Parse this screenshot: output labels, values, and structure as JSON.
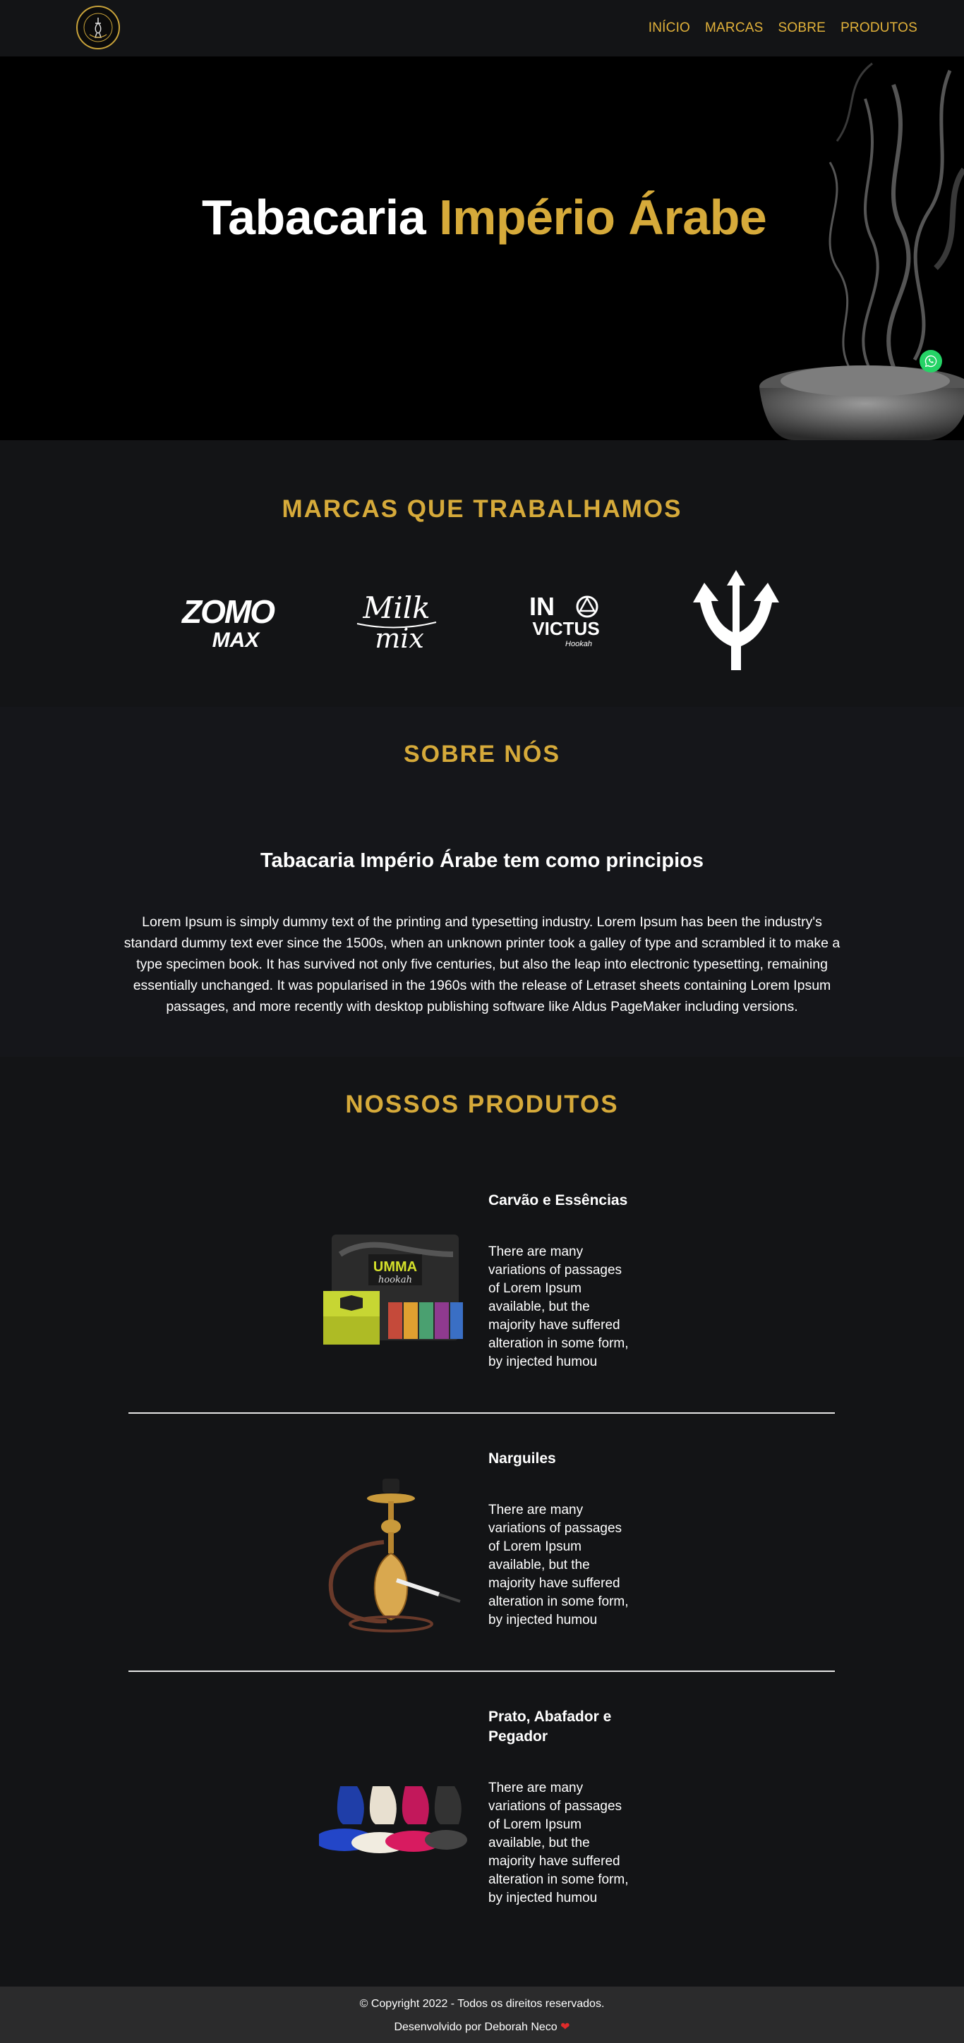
{
  "nav": {
    "logo_alt": "Tabacaria Império Árabe",
    "items": [
      {
        "label": "INÍCIO"
      },
      {
        "label": "MARCAS"
      },
      {
        "label": "SOBRE"
      },
      {
        "label": "PRODUTOS"
      }
    ]
  },
  "hero": {
    "title_white": "Tabacaria ",
    "title_gold": "Império Árabe"
  },
  "whatsapp": {
    "icon": "whatsapp-icon"
  },
  "brands": {
    "title": "MARCAS QUE TRABALHAMOS",
    "logos": [
      {
        "name": "Zomo Max",
        "text_1": "ZOMO",
        "text_2": "MAX"
      },
      {
        "name": "Milk Mix",
        "text_1": "Milk",
        "text_2": "mix"
      },
      {
        "name": "Invictus Hookah",
        "text_1": "IN",
        "text_2": "VICTUS",
        "text_3": "Hookah"
      },
      {
        "name": "Triton",
        "icon": "trident-icon"
      }
    ]
  },
  "about": {
    "title": "SOBRE NÓS",
    "subtitle": "Tabacaria Império Árabe tem como principios",
    "body": "Lorem Ipsum is simply dummy text of the printing and typesetting industry. Lorem Ipsum has been the industry's standard dummy text ever since the 1500s, when an unknown printer took a galley of type and scrambled it to make a type specimen book. It has survived not only five centuries, but also the leap into electronic typesetting, remaining essentially unchanged. It was popularised in the 1960s with the release of Letraset sheets containing Lorem Ipsum passages, and more recently with desktop publishing software like Aldus PageMaker including versions."
  },
  "products": {
    "title": "NOSSOS PRODUTOS",
    "items": [
      {
        "title": "Carvão e Essências",
        "desc": "There are many variations of passages of Lorem Ipsum available, but the majority have suffered alteration in some form, by injected humou",
        "img_label_1": "UMMA",
        "img_label_2": "hookah"
      },
      {
        "title": "Narguiles",
        "desc": "There are many variations of passages of Lorem Ipsum available, but the majority have suffered alteration in some form, by injected humou"
      },
      {
        "title": "Prato, Abafador e Pegador",
        "desc": "There are many variations of passages of Lorem Ipsum available, but the majority have suffered alteration in some form, by injected humou"
      }
    ]
  },
  "footer": {
    "copyright": "© Copyright 2022 - Todos os direitos reservados.",
    "credit": "Desenvolvido por Deborah Neco",
    "heart": "❤"
  },
  "colors": {
    "gold": "#d6aa3a",
    "background": "#131416",
    "footer": "#2b2b2c",
    "whatsapp": "#25d366"
  }
}
